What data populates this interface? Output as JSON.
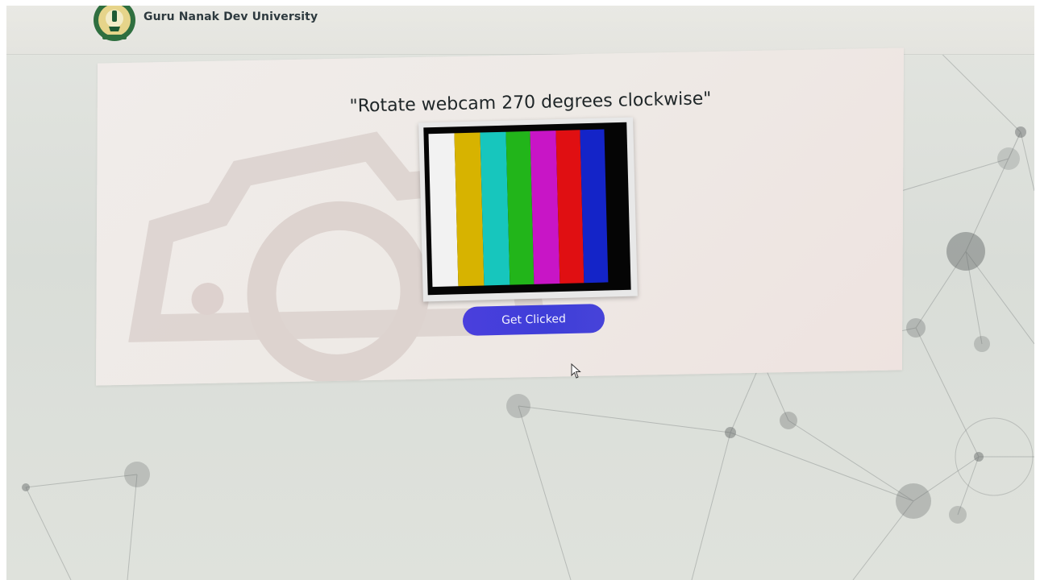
{
  "header": {
    "site_title": "Guru Nanak Dev University",
    "logo_icon": "university-emblem-icon"
  },
  "captcha": {
    "instruction": "\"Rotate webcam 270 degrees clockwise\"",
    "image_icon": "color-bars-test-pattern-icon",
    "bars": [
      "#f2f2f2",
      "#d7b300",
      "#17c6bd",
      "#22b51a",
      "#c815c6",
      "#e00f12",
      "#1424c8"
    ],
    "button_label": "Get Clicked"
  },
  "colors": {
    "accent": "#3f3fd8",
    "title_text": "#2e3a3f",
    "page_background": "#dcdfda"
  },
  "cursor_icon": "mouse-pointer-icon",
  "background_icon": "network-nodes-graphic-icon",
  "watermark_icon": "camera-watermark-icon"
}
